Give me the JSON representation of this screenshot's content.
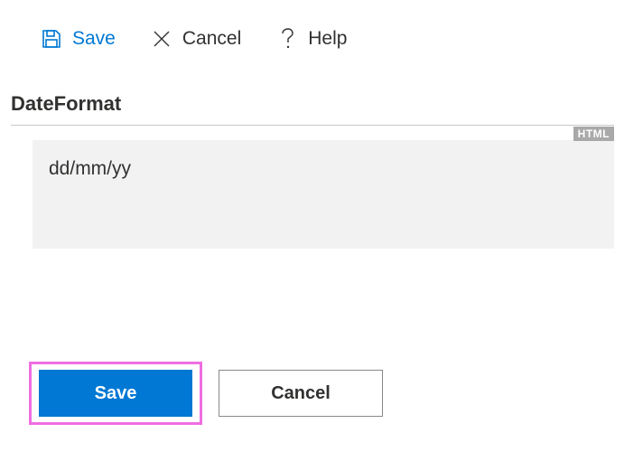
{
  "toolbar": {
    "save_label": "Save",
    "cancel_label": "Cancel",
    "help_label": "Help"
  },
  "field": {
    "label": "DateFormat",
    "value": "dd/mm/yy",
    "badge": "HTML"
  },
  "buttons": {
    "save": "Save",
    "cancel": "Cancel"
  }
}
